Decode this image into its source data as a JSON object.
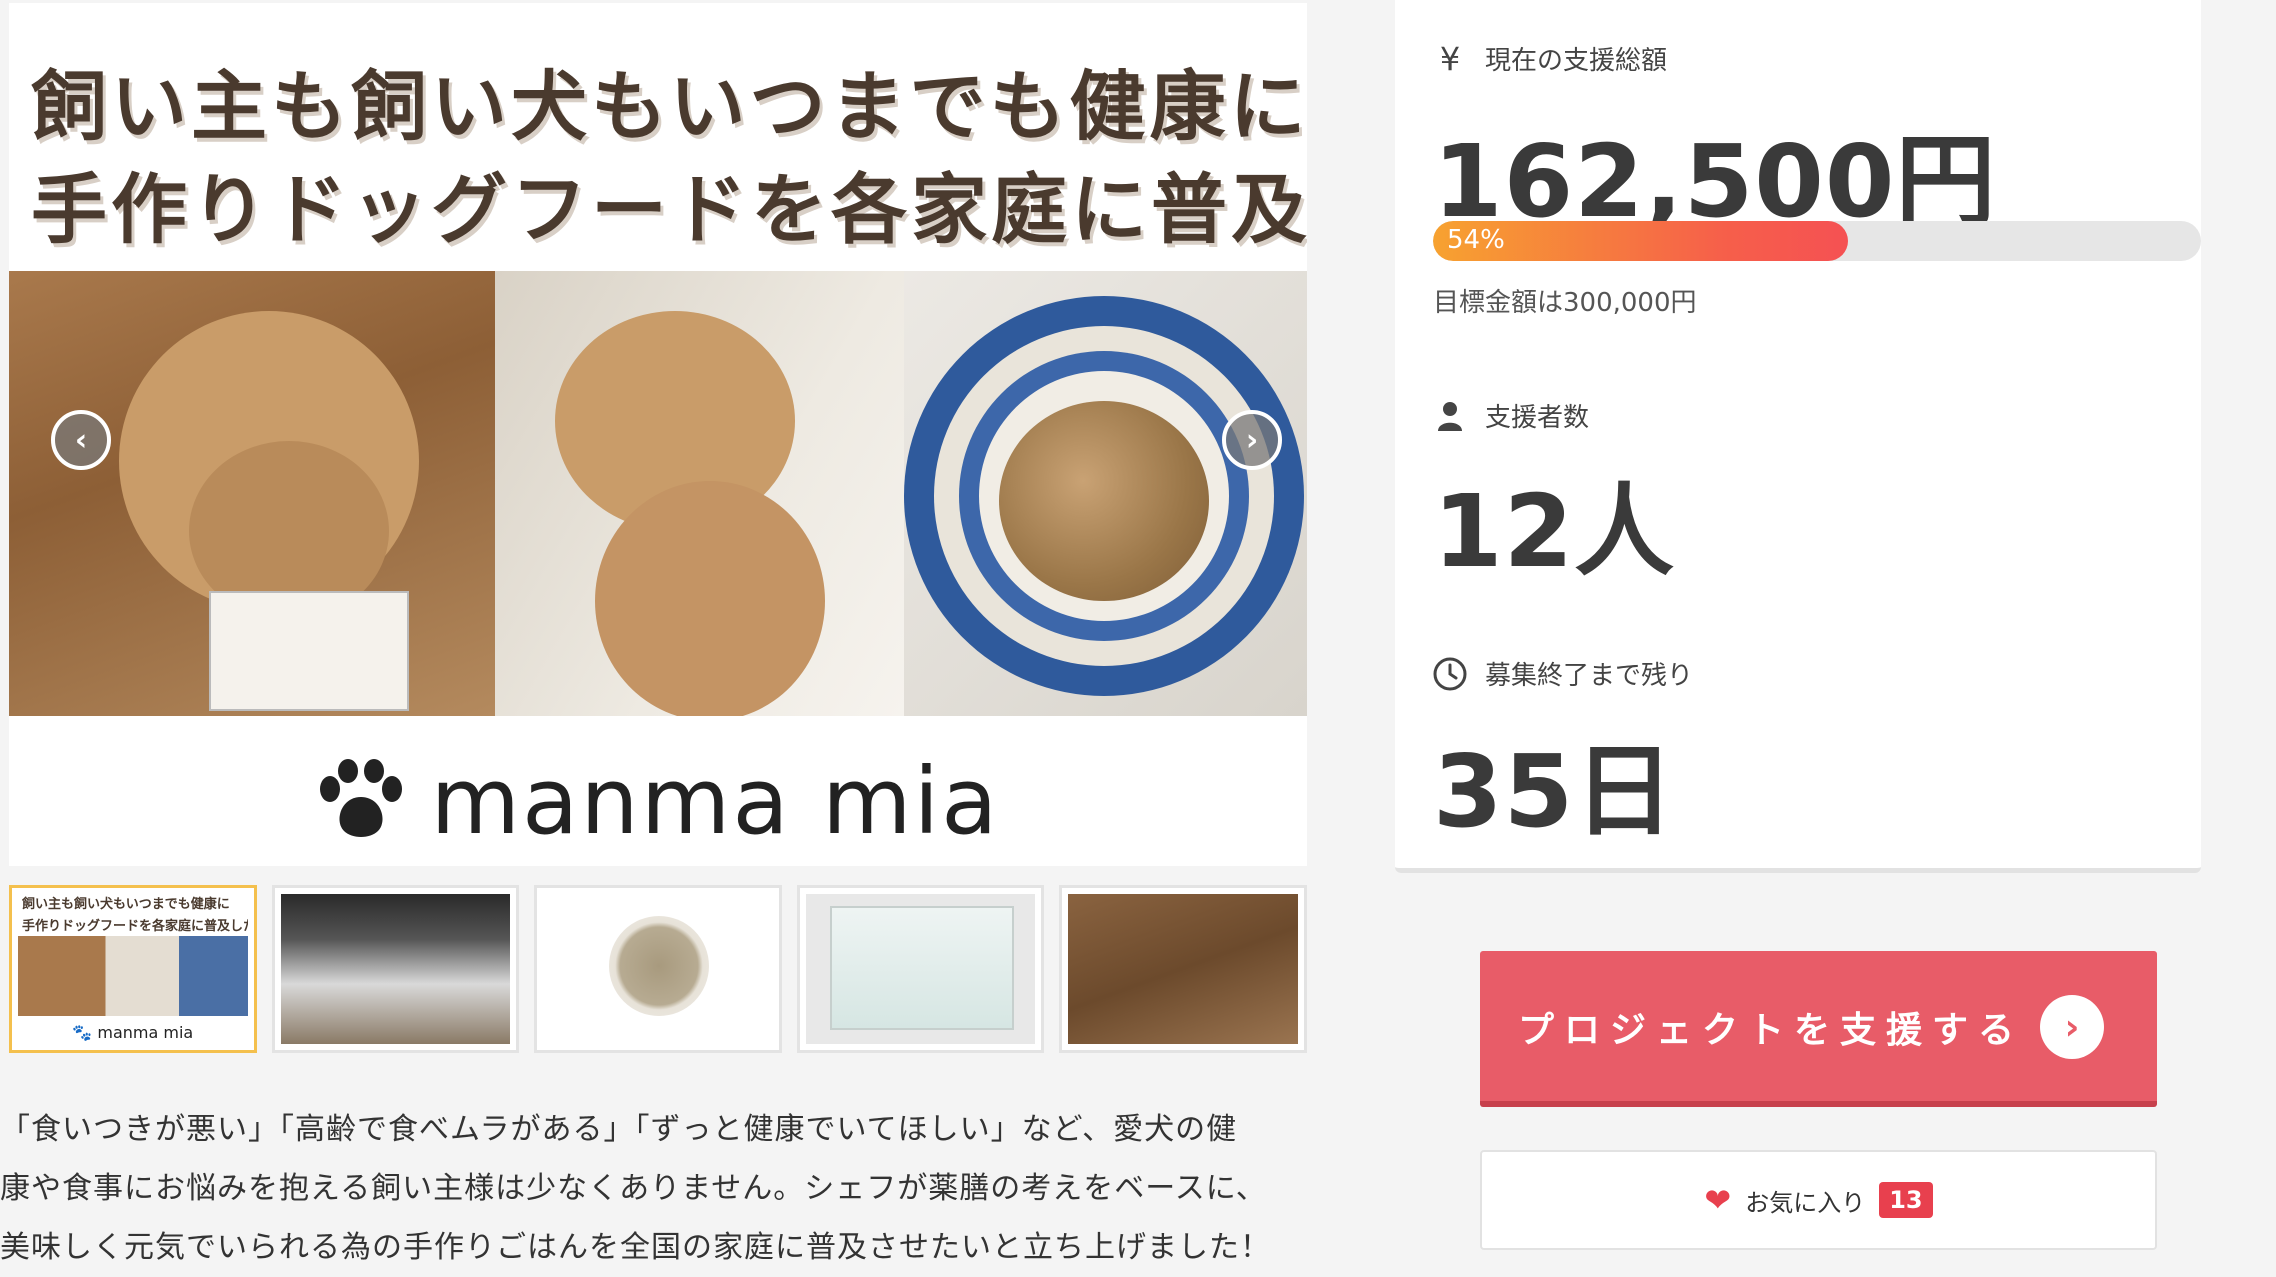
{
  "hero": {
    "title_line1": "飼い主も飼い犬もいつまでも健康に",
    "title_line2": "手作りドッグフードを各家庭に普及したい",
    "brand": "manma mia",
    "prev_icon": "chevron-left-icon",
    "next_icon": "chevron-right-icon"
  },
  "thumbnails": [
    {
      "title": "飼い主も飼い犬もいつまでも健康に",
      "title2": "手作りドッグフードを各家庭に普及したい",
      "brand": "manma mia",
      "active": true
    },
    {
      "active": false
    },
    {
      "active": false
    },
    {
      "active": false
    },
    {
      "active": false
    }
  ],
  "description": {
    "line1": "「食いつきが悪い」「高齢で食べムラがある」「ずっと健康でいてほしい」など、愛犬の健",
    "line2": "康や食事にお悩みを抱える飼い主様は少なくありません。シェフが薬膳の考えをベースに、",
    "line3": "美味しく元気でいられる為の手作りごはんを全国の家庭に普及させたいと立ち上げました！"
  },
  "stats": {
    "total": {
      "icon": "yen-icon",
      "icon_glyph": "¥",
      "label": "現在の支援総額",
      "value": "162,500円"
    },
    "progress": {
      "percent": 54,
      "label": "54%"
    },
    "goal": "目標金額は300,000円",
    "backers": {
      "icon": "user-icon",
      "label": "支援者数",
      "value": "12人"
    },
    "remaining": {
      "icon": "clock-icon",
      "label": "募集終了まで残り",
      "value": "35日"
    }
  },
  "actions": {
    "support_label": "プロジェクトを支援する",
    "support_icon": "chevron-right-circle-icon",
    "favorite_icon": "heart-icon",
    "favorite_label": "お気に入り",
    "favorite_count": "13"
  },
  "colors": {
    "accent": "#e85c68",
    "progress_start": "#f7a230",
    "progress_end": "#f55153",
    "thumb_active": "#f4c04d",
    "favorite": "#e8404e"
  }
}
